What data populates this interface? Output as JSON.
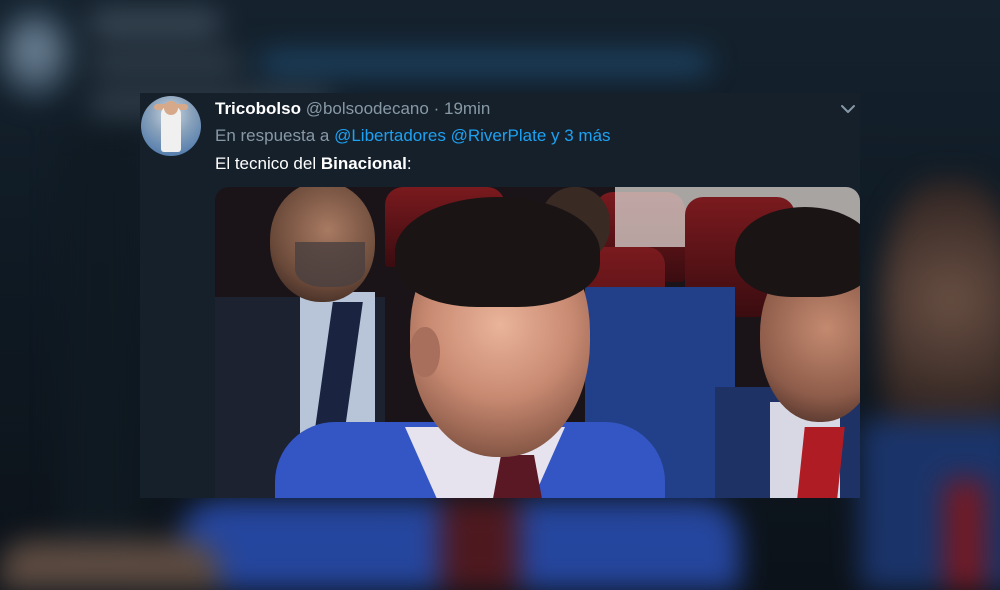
{
  "tweet": {
    "display_name": "Tricobolso",
    "handle": "@bolsoodecano",
    "separator": "·",
    "time": "19min",
    "reply_prefix": "En respuesta a",
    "reply_mentions": [
      "@Libertadores",
      "@RiverPlate",
      "y 3 más"
    ],
    "text_prefix": "El tecnico del ",
    "text_bold": "Binacional",
    "text_suffix": ":",
    "menu_icon": "chevron-down-icon"
  },
  "colors": {
    "background": "#15202b",
    "primary_text": "#ffffff",
    "secondary_text": "#8899a6",
    "accent": "#1da1f2"
  }
}
